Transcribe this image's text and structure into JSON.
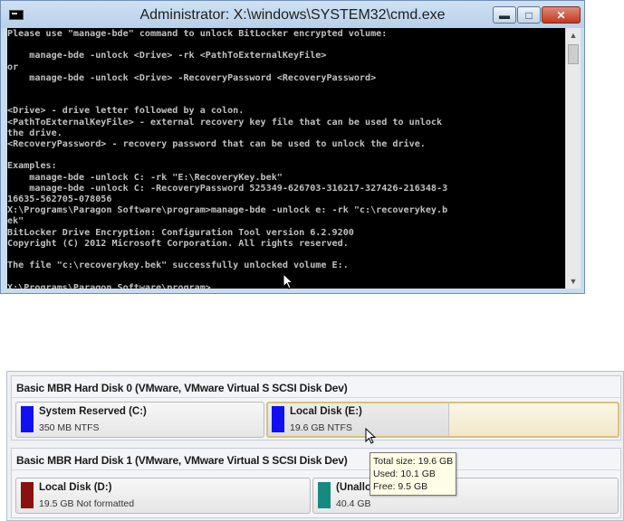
{
  "cmd": {
    "title": "Administrator: X:\\windows\\SYSTEM32\\cmd.exe",
    "buttons": {
      "minimize": "▬",
      "maximize": "□",
      "close": "✕"
    },
    "output": "Please use \"manage-bde\" command to unlock BitLocker encrypted volume:\n\n    manage-bde -unlock <Drive> -rk <PathToExternalKeyFile>\nor\n    manage-bde -unlock <Drive> -RecoveryPassword <RecoveryPassword>\n\n\n<Drive> - drive letter followed by a colon.\n<PathToExternalKeyFile> - external recovery key file that can be used to unlock\nthe drive.\n<RecoveryPassword> - recovery password that can be used to unlock the drive.\n\nExamples:\n    manage-bde -unlock C: -rk \"E:\\RecoveryKey.bek\"\n    manage-bde -unlock C: -RecoveryPassword 525349-626703-316217-327426-216348-3\n16635-562705-078056\nX:\\Programs\\Paragon Software\\program>manage-bde -unlock e: -rk \"c:\\recoverykey.b\nek\"\nBitLocker Drive Encryption: Configuration Tool version 6.2.9200\nCopyright (C) 2012 Microsoft Corporation. All rights reserved.\n\nThe file \"c:\\recoverykey.bek\" successfully unlocked volume E:.\n\nX:\\Programs\\Paragon Software\\program>",
    "scroll_up": "▲",
    "scroll_down": "▼"
  },
  "disks": [
    {
      "title": "Basic MBR Hard Disk 0 (VMware, VMware Virtual S SCSI Disk Dev)",
      "partitions": [
        {
          "name": "System Reserved (C:)",
          "size": "350 MB NTFS",
          "color": "#1010f0"
        },
        {
          "name": "Local Disk (E:)",
          "size": "19.6 GB NTFS",
          "color": "#1010f0"
        }
      ]
    },
    {
      "title": "Basic MBR Hard Disk 1 (VMware, VMware Virtual S SCSI Disk Dev)",
      "partitions": [
        {
          "name": "Local Disk (D:)",
          "size": "19.5 GB Not formatted",
          "color": "#8b1010"
        },
        {
          "name": "(Unallo",
          "size": "40.4 GB",
          "color": "#168a80"
        }
      ]
    }
  ],
  "tooltip": {
    "total": "Total size: 19.6 GB",
    "used": "Used: 10.1 GB",
    "free": "Free: 9.5 GB"
  }
}
